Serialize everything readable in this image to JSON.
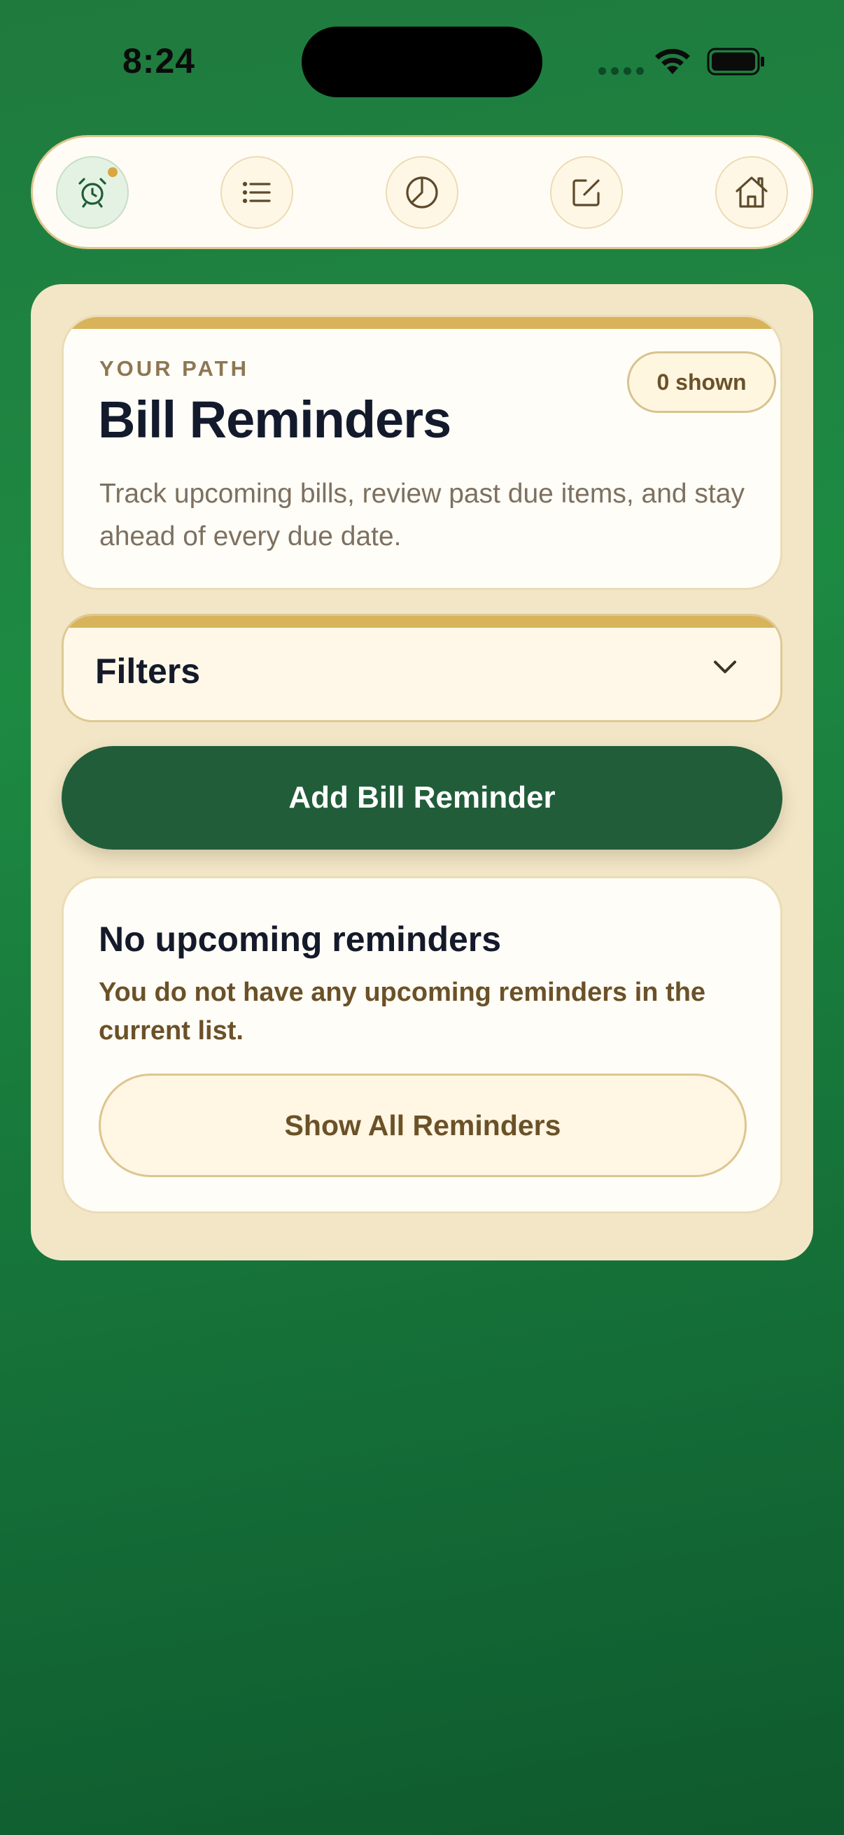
{
  "status_bar": {
    "time": "8:24"
  },
  "top_nav": {
    "items": [
      {
        "name": "alarm-clock-icon",
        "active": true
      },
      {
        "name": "list-icon",
        "active": false
      },
      {
        "name": "pie-chart-icon",
        "active": false
      },
      {
        "name": "edit-icon",
        "active": false
      },
      {
        "name": "home-icon",
        "active": false
      }
    ]
  },
  "hero": {
    "eyebrow": "YOUR PATH",
    "title": "Bill Reminders",
    "description": "Track upcoming bills, review past due items, and stay ahead of every due date.",
    "count_badge": "0 shown"
  },
  "filters": {
    "label": "Filters"
  },
  "actions": {
    "add_label": "Add Bill Reminder"
  },
  "empty_state": {
    "title": "No upcoming reminders",
    "description": "You do not have any upcoming reminders in the current list.",
    "show_all_label": "Show All Reminders"
  },
  "colors": {
    "background": "#1d8a42",
    "primary_button": "#225d3a",
    "panel": "#f2e6c6",
    "accent": "#d8b35a",
    "text_dark": "#131a2c",
    "text_brown": "#6b5128"
  }
}
